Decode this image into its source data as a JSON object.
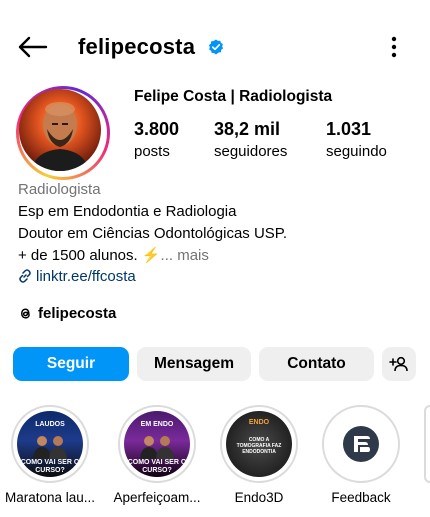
{
  "header": {
    "username": "felipecosta",
    "back_icon": "arrow-left-icon",
    "verified_icon": "verified-badge-icon",
    "more_icon": "more-vertical-icon"
  },
  "profile": {
    "full_name": "Felipe Costa | Radiologista",
    "stats": [
      {
        "value": "3.800",
        "label": "posts"
      },
      {
        "value": "38,2 mil",
        "label": "seguidores"
      },
      {
        "value": "1.031",
        "label": "seguindo"
      }
    ],
    "category": "Radiologista",
    "bio_line1": "Esp em Endodontia e Radiologia",
    "bio_line2": "Doutor em Ciências Odontológicas USP.",
    "bio_line3_prefix": "+ de 1500 alunos. ",
    "bio_line3_emoji": "⚡",
    "bio_line3_more": "... mais",
    "link": "linktr.ee/ffcosta",
    "threads_handle": "felipecosta"
  },
  "buttons": {
    "follow": "Seguir",
    "message": "Mensagem",
    "contact": "Contato",
    "add_user_icon": "add-user-icon"
  },
  "highlights": [
    {
      "label": "Maratona lau...",
      "cover_top": "LAUDOS",
      "cover_bottom": "COMO VAI SER O CURSO?"
    },
    {
      "label": "Aperfeiçoam...",
      "cover_top": "EM ENDO",
      "cover_bottom": "COMO VAI SER O CURSO?"
    },
    {
      "label": "Endo3D",
      "cover_top": "ENDO",
      "cover_bottom": "COMO A TOMOGRAFIA FAZ ENDODONTIA"
    },
    {
      "label": "Feedback",
      "cover_top": "",
      "cover_bottom": ""
    }
  ],
  "colors": {
    "accent": "#0095f6",
    "link": "#00376b",
    "secondary_text": "#737373",
    "button_bg": "#efefef"
  }
}
